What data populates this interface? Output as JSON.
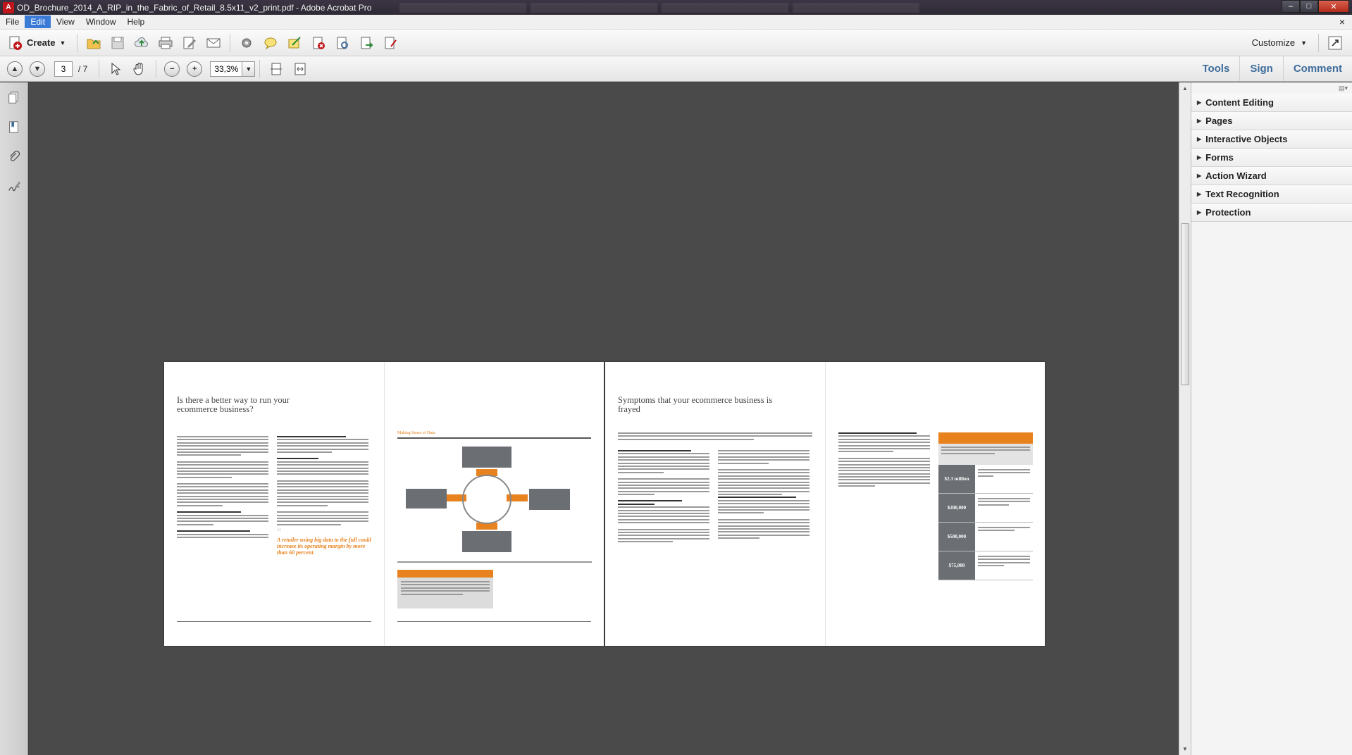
{
  "window": {
    "title": "OD_Brochure_2014_A_RIP_in_the_Fabric_of_Retail_8.5x11_v2_print.pdf - Adobe Acrobat Pro",
    "app_badge": "A",
    "minimize": "–",
    "maximize": "□",
    "close": "✕"
  },
  "menu": {
    "items": [
      "File",
      "Edit",
      "View",
      "Window",
      "Help"
    ],
    "active": "Edit",
    "doc_close": "×"
  },
  "toolbar": {
    "create_label": "Create",
    "customize_label": "Customize",
    "icons": [
      "open-folder-icon",
      "save-icon",
      "cloud-upload-icon",
      "print-icon",
      "edit-icon",
      "email-icon",
      "gear-icon",
      "comment-icon",
      "sign-icon",
      "delete-page-icon",
      "scan-icon",
      "export-icon",
      "stamp-icon"
    ]
  },
  "nav": {
    "current_page": "3",
    "total_pages": "/ 7",
    "zoom": "33,3%"
  },
  "right_tabs": [
    "Tools",
    "Sign",
    "Comment"
  ],
  "panel": {
    "items": [
      "Content Editing",
      "Pages",
      "Interactive Objects",
      "Forms",
      "Action Wizard",
      "Text Recognition",
      "Protection"
    ]
  },
  "colors": {
    "accent": "#e8821e",
    "grey_box": "#6b6e73",
    "tab_blue": "#3f6d9b"
  },
  "document": {
    "spread1": {
      "left_page": {
        "title": "Is there a better way to run your ecommerce business?",
        "pull_quote": "A retailer using big data to the full could increase its operating margin by more than 60 percent."
      },
      "right_page": {
        "diagram_title": "Making Sense of Data"
      }
    },
    "spread2": {
      "left_page": {
        "title": "Symptoms that your ecommerce business is frayed"
      },
      "right_page": {
        "table_values": [
          "$2.3 million",
          "$200,000",
          "$500,000",
          "$75,000"
        ]
      }
    }
  }
}
